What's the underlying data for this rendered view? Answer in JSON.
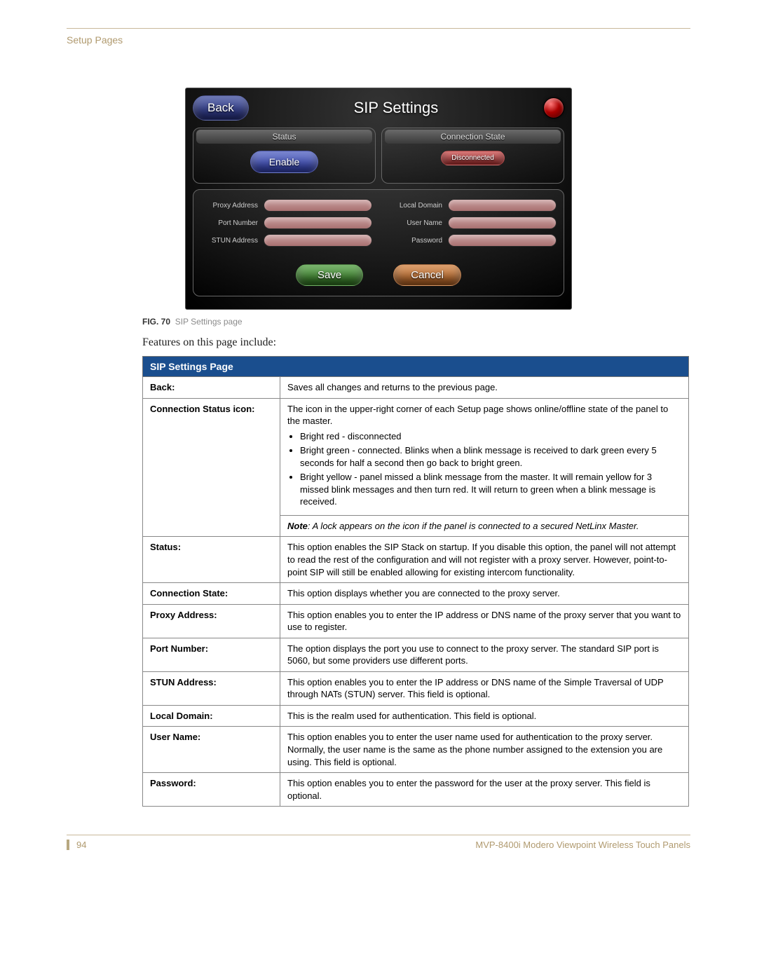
{
  "section_label": "Setup Pages",
  "ui": {
    "title": "SIP Settings",
    "back_button": "Back",
    "status_header": "Status",
    "conn_header": "Connection State",
    "enable_button": "Enable",
    "disconnected_pill": "Disconnected",
    "fields_left": [
      {
        "label": "Proxy Address"
      },
      {
        "label": "Port Number"
      },
      {
        "label": "STUN Address"
      }
    ],
    "fields_right": [
      {
        "label": "Local Domain"
      },
      {
        "label": "User Name"
      },
      {
        "label": "Password"
      }
    ],
    "save_button": "Save",
    "cancel_button": "Cancel"
  },
  "figure": {
    "number": "FIG. 70",
    "caption": "SIP Settings page"
  },
  "intro_text": "Features on this page include:",
  "table": {
    "title": "SIP Settings Page",
    "rows": [
      {
        "k": "Back:",
        "v": "Saves all changes and returns to the previous page."
      },
      {
        "k": "Connection Status icon:",
        "v_intro": "The icon in the upper-right corner of each Setup page shows online/offline state of the panel to the master.",
        "bullets": [
          "Bright red - disconnected",
          "Bright green - connected. Blinks when a blink message is received to dark green every 5 seconds for half a second then go back to bright green.",
          "Bright yellow - panel missed a blink message from the master. It will remain yellow for 3 missed blink messages and then turn red. It will return to green when a blink message is received."
        ],
        "note_label": "Note",
        "note": ": A lock appears on the icon if the panel is connected to a secured NetLinx Master."
      },
      {
        "k": "Status:",
        "v": "This option enables the SIP Stack on startup. If you disable this option, the panel will not attempt to read the rest of the configuration and will not register with a proxy server. However, point-to-point SIP will still be enabled allowing for existing intercom functionality."
      },
      {
        "k": "Connection State:",
        "v": "This option displays whether you are connected to the proxy server."
      },
      {
        "k": "Proxy Address:",
        "v": "This option enables you to enter the IP address or DNS name of the proxy server that you want to use to register."
      },
      {
        "k": "Port Number:",
        "v": "The option displays the port you use to connect to the proxy server. The standard SIP port is 5060, but some providers use different ports."
      },
      {
        "k": "STUN Address:",
        "v": "This option enables you to enter the IP address or DNS name of the Simple Traversal of UDP through NATs (STUN) server. This field is optional."
      },
      {
        "k": "Local Domain:",
        "v": "This is the realm used for authentication. This field is optional."
      },
      {
        "k": "User Name:",
        "v": "This option enables you to enter the user name used for authentication to the proxy server. Normally, the user name is the same as the phone number assigned to the extension you are using. This field is optional."
      },
      {
        "k": "Password:",
        "v": "This option enables you to enter the password for the user at the proxy server. This field is optional."
      }
    ]
  },
  "footer": {
    "page_number": "94",
    "doc_title": "MVP-8400i Modero Viewpoint Wireless Touch Panels"
  }
}
